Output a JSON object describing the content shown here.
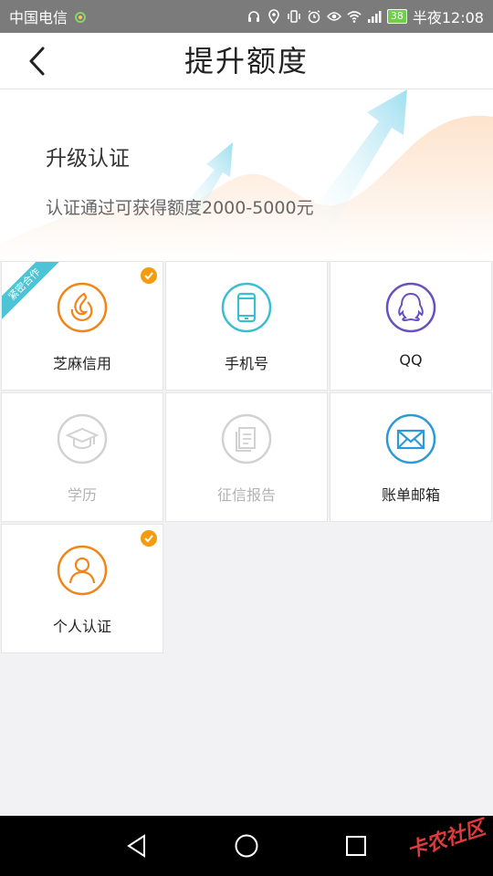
{
  "status_bar": {
    "carrier": "中国电信",
    "battery": "38",
    "time": "半夜12:08",
    "icons": [
      "headset-icon",
      "location-icon",
      "vibrate-icon",
      "alarm-icon",
      "eye-icon",
      "wifi-icon",
      "signal-icon",
      "battery-icon"
    ]
  },
  "header": {
    "title": "提升额度",
    "back_icon": "chevron-left-icon"
  },
  "banner": {
    "title": "升级认证",
    "subtitle": "认证通过可获得额度2000-5000元"
  },
  "cards": [
    {
      "label": "芝麻信用",
      "icon": "sesame-flame-icon",
      "color": "#f08519",
      "checked": true,
      "enabled": true,
      "ribbon": "紧密合作"
    },
    {
      "label": "手机号",
      "icon": "phone-icon",
      "color": "#3bbfd0",
      "checked": false,
      "enabled": true
    },
    {
      "label": "QQ",
      "icon": "qq-penguin-icon",
      "color": "#6a4fbf",
      "checked": false,
      "enabled": true
    },
    {
      "label": "学历",
      "icon": "graduation-cap-icon",
      "color": "#cfcfcf",
      "checked": false,
      "enabled": false
    },
    {
      "label": "征信报告",
      "icon": "document-icon",
      "color": "#cfcfcf",
      "checked": false,
      "enabled": false
    },
    {
      "label": "账单邮箱",
      "icon": "envelope-icon",
      "color": "#2b9ad6",
      "checked": false,
      "enabled": true
    },
    {
      "label": "个人认证",
      "icon": "person-icon",
      "color": "#f08519",
      "checked": true,
      "enabled": true
    }
  ],
  "nav_bar": {
    "back": "nav-back-icon",
    "home": "nav-home-icon",
    "recent": "nav-recent-icon",
    "watermark": "卡农社区"
  }
}
